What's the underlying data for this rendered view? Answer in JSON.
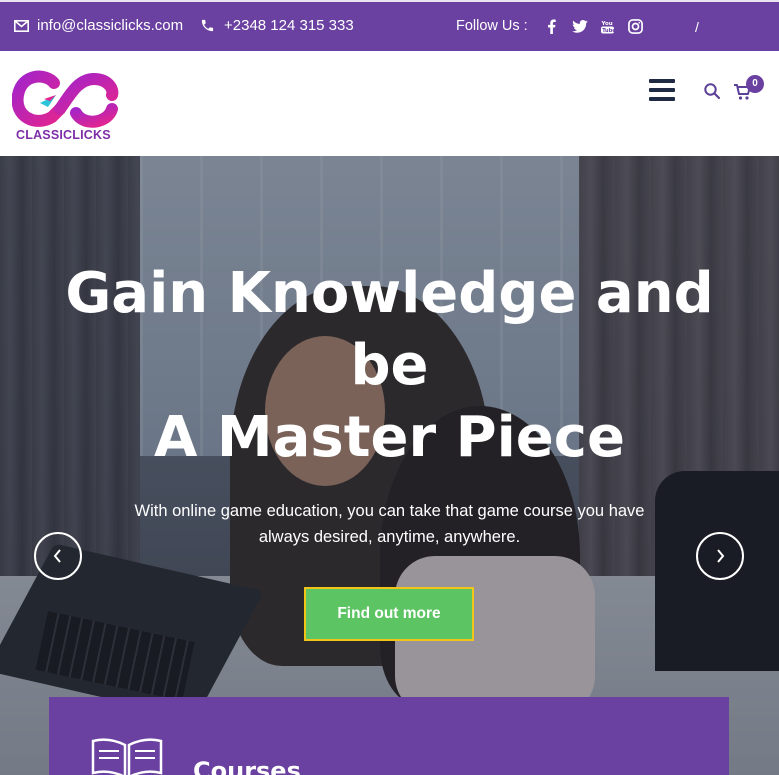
{
  "topbar": {
    "email": "info@classiclicks.com",
    "phone": "+2348 124 315 333",
    "follow_label": "Follow Us :",
    "social": [
      "facebook-icon",
      "twitter-icon",
      "youtube-icon",
      "instagram-icon"
    ],
    "separator": "/",
    "background": "#6a40a0"
  },
  "header": {
    "logo_text": "CLASSICLICKS",
    "cart_count": "0"
  },
  "hero": {
    "title_line1": "Gain Knowledge and",
    "title_line2": "be",
    "title_line3": "A Master Piece",
    "subtitle_line1": "With online game education, you can take that game course you have",
    "subtitle_line2": "always desired, anytime, anywhere.",
    "cta_label": "Find out more",
    "cta_color": "#5dc464"
  },
  "courses_card": {
    "title": "Courses",
    "icon": "book-icon"
  }
}
